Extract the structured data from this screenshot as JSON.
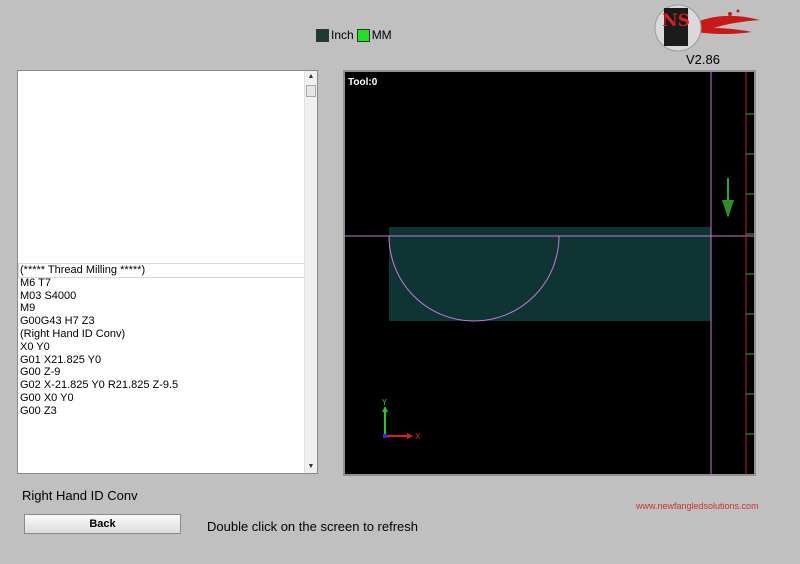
{
  "units": {
    "inch_label": "Inch",
    "mm_label": "MM",
    "inch_color": "#1f3b2c",
    "mm_color": "#22e022"
  },
  "logo": {
    "text": "NS"
  },
  "version": "V2.86",
  "code_lines": [
    "(***** Thread Milling *****)",
    "M6 T7",
    "M03 S4000",
    "M9",
    "G00G43 H7 Z3",
    "(Right Hand ID Conv)",
    "X0 Y0",
    "G01 X21.825 Y0",
    "G00 Z-9",
    "G02 X-21.825 Y0 R21.825 Z-9.5",
    "G00 X0 Y0",
    "G00 Z3"
  ],
  "selected_line": 0,
  "viewport": {
    "tool_label": "Tool:0",
    "background": "#000000",
    "stock_color": "#0e3434",
    "path_color": "#c878d8",
    "axis_x_label": "X",
    "axis_y_label": "Y"
  },
  "program_name": "Right Hand ID Conv",
  "back_label": "Back",
  "refresh_hint": "Double click on the screen to refresh",
  "website": "www.newfangledsolutions.com"
}
